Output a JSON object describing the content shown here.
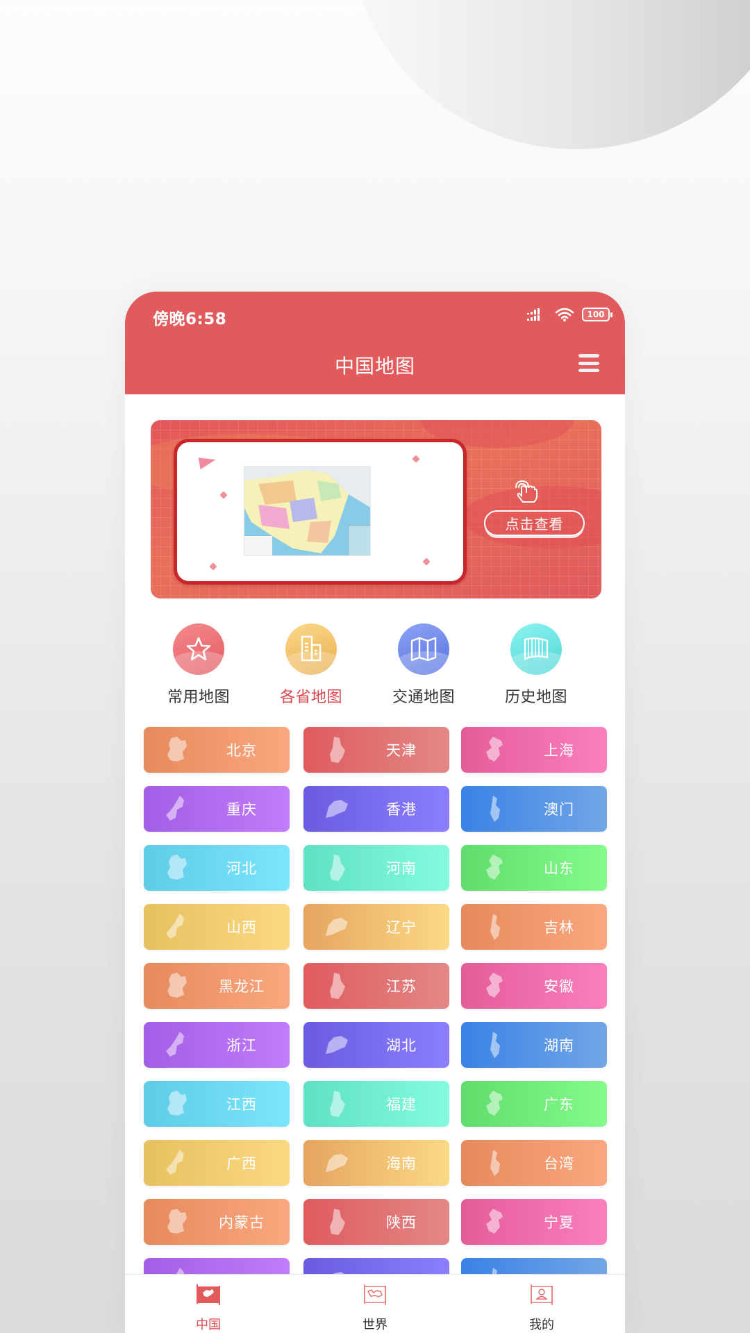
{
  "status_bar": {
    "time": "傍晚6:58",
    "battery": "100"
  },
  "header": {
    "title": "中国地图",
    "menu_icon": "hamburger-menu-icon"
  },
  "banner": {
    "button_label": "点击查看",
    "icon": "tap-hand-icon",
    "thumbnail": "china-map-thumbnail"
  },
  "categories": [
    {
      "label": "常用地图",
      "icon": "star-icon",
      "active": false,
      "color_from": "#f58a8c",
      "color_to": "#e25a63"
    },
    {
      "label": "各省地图",
      "icon": "buildings-icon",
      "active": true,
      "color_from": "#fbd98a",
      "color_to": "#e8ae4f"
    },
    {
      "label": "交通地图",
      "icon": "folded-map-icon",
      "active": false,
      "color_from": "#8ea4f5",
      "color_to": "#5672e0"
    },
    {
      "label": "历史地图",
      "icon": "scroll-icon",
      "active": false,
      "color_from": "#8cf3f0",
      "color_to": "#4fd6d6"
    }
  ],
  "provinces": [
    {
      "name": "北京",
      "from": "#e58a5d",
      "to": "#fba77f"
    },
    {
      "name": "天津",
      "from": "#e05b5e",
      "to": "#e28886"
    },
    {
      "name": "上海",
      "from": "#e45c9a",
      "to": "#fb7fbd"
    },
    {
      "name": "重庆",
      "from": "#a25ee5",
      "to": "#c17cfb"
    },
    {
      "name": "香港",
      "from": "#6a5be0",
      "to": "#8b7ffe"
    },
    {
      "name": "澳门",
      "from": "#3a82e6",
      "to": "#72a6e6"
    },
    {
      "name": "河北",
      "from": "#5fcbe6",
      "to": "#7be6fb"
    },
    {
      "name": "河南",
      "from": "#5fe0c4",
      "to": "#84fbde"
    },
    {
      "name": "山东",
      "from": "#60dd6e",
      "to": "#84fb8a"
    },
    {
      "name": "山西",
      "from": "#e7c05f",
      "to": "#fbd983"
    },
    {
      "name": "辽宁",
      "from": "#e6a55f",
      "to": "#fbd985"
    },
    {
      "name": "吉林",
      "from": "#e58a5d",
      "to": "#fba77f"
    },
    {
      "name": "黑龙江",
      "from": "#e58a5d",
      "to": "#fba77f"
    },
    {
      "name": "江苏",
      "from": "#e05b5e",
      "to": "#e28886"
    },
    {
      "name": "安徽",
      "from": "#e45c9a",
      "to": "#fb7fbd"
    },
    {
      "name": "浙江",
      "from": "#a25ee5",
      "to": "#c17cfb"
    },
    {
      "name": "湖北",
      "from": "#6a5be0",
      "to": "#8b7ffe"
    },
    {
      "name": "湖南",
      "from": "#3a82e6",
      "to": "#72a6e6"
    },
    {
      "name": "江西",
      "from": "#5fcbe6",
      "to": "#7be6fb"
    },
    {
      "name": "福建",
      "from": "#5fe0c4",
      "to": "#84fbde"
    },
    {
      "name": "广东",
      "from": "#60dd6e",
      "to": "#84fb8a"
    },
    {
      "name": "广西",
      "from": "#e7c05f",
      "to": "#fbd983"
    },
    {
      "name": "海南",
      "from": "#e6a55f",
      "to": "#fbd985"
    },
    {
      "name": "台湾",
      "from": "#e58a5d",
      "to": "#fba77f"
    },
    {
      "name": "内蒙古",
      "from": "#e58a5d",
      "to": "#fba77f"
    },
    {
      "name": "陕西",
      "from": "#e05b5e",
      "to": "#e28886"
    },
    {
      "name": "宁夏",
      "from": "#e45c9a",
      "to": "#fb7fbd"
    },
    {
      "name": "",
      "from": "#a25ee5",
      "to": "#c17cfb"
    },
    {
      "name": "",
      "from": "#6a5be0",
      "to": "#8b7ffe"
    },
    {
      "name": "",
      "from": "#3a82e6",
      "to": "#72a6e6"
    }
  ],
  "bottom_nav": [
    {
      "label": "中国",
      "icon": "china-scroll-icon",
      "active": true
    },
    {
      "label": "世界",
      "icon": "world-scroll-icon",
      "active": false
    },
    {
      "label": "我的",
      "icon": "profile-scroll-icon",
      "active": false
    }
  ],
  "colors": {
    "primary": "#e15b5d",
    "active_text": "#d9484e",
    "text": "#333333"
  }
}
